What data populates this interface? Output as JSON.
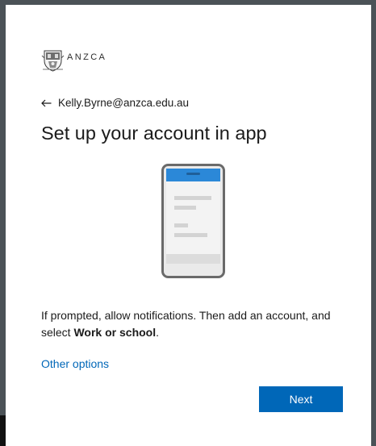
{
  "brand": {
    "name": "ANZCA",
    "crest_tagline": "",
    "icon": "crest-logo"
  },
  "account": {
    "back_icon": "arrow-left-icon",
    "email": "Kelly.Byrne@anzca.edu.au"
  },
  "page": {
    "title": "Set up your account in app",
    "illustration_icon": "phone-app-icon",
    "instruction_prefix": "If prompted, allow notifications. Then add an account, and select ",
    "instruction_bold": "Work or school",
    "instruction_suffix": "."
  },
  "links": {
    "other_options": "Other options"
  },
  "actions": {
    "next_label": "Next"
  },
  "colors": {
    "accent": "#0067b8",
    "phone_header": "#2b88d8",
    "frame": "#4b5257"
  }
}
